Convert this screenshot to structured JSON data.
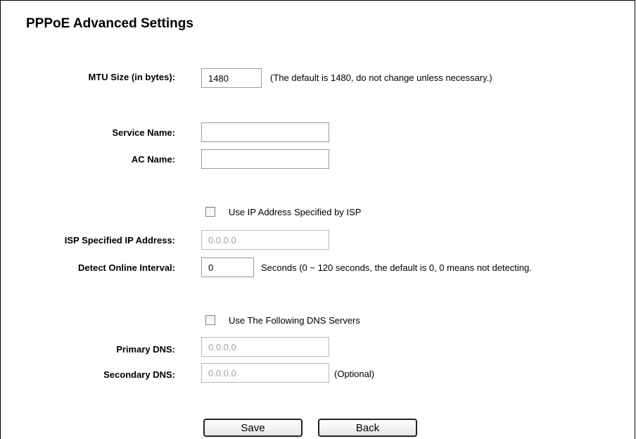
{
  "page": {
    "title": "PPPoE Advanced Settings"
  },
  "mtu": {
    "label": "MTU Size (in bytes):",
    "value": "1480",
    "note": "(The default is 1480, do not change unless necessary.)"
  },
  "service_name": {
    "label": "Service Name:",
    "value": ""
  },
  "ac_name": {
    "label": "AC Name:",
    "value": ""
  },
  "use_isp_ip": {
    "label": "Use IP Address Specified by ISP",
    "checked": false
  },
  "isp_ip": {
    "label": "ISP Specified IP Address:",
    "placeholder": "0.0.0.0"
  },
  "detect_interval": {
    "label": "Detect Online Interval:",
    "value": "0",
    "note": "Seconds (0 ~ 120 seconds, the default is 0, 0 means not detecting."
  },
  "use_dns": {
    "label": "Use The Following DNS Servers",
    "checked": false
  },
  "primary_dns": {
    "label": "Primary DNS:",
    "placeholder": "0.0.0.0"
  },
  "secondary_dns": {
    "label": "Secondary DNS:",
    "placeholder": "0.0.0.0",
    "note": "(Optional)"
  },
  "buttons": {
    "save": "Save",
    "back": "Back"
  }
}
